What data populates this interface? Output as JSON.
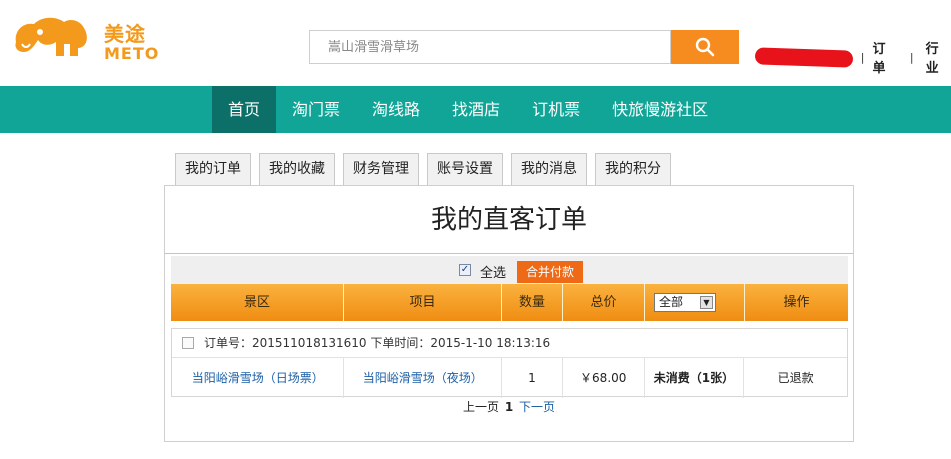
{
  "brand": {
    "name_cn": "美途",
    "name_en": "METO",
    "color": "#f39a1d"
  },
  "search": {
    "placeholder": "嵩山滑雪滑草场",
    "button_icon": "search-icon"
  },
  "userbar": {
    "orders_label": "订单",
    "industry_label": "行业",
    "separator": "|"
  },
  "nav": {
    "color": "#11a598",
    "items": [
      {
        "label": "首页",
        "active": true
      },
      {
        "label": "淘门票"
      },
      {
        "label": "淘线路"
      },
      {
        "label": "找酒店"
      },
      {
        "label": "订机票"
      },
      {
        "label": "快旅慢游社区"
      }
    ]
  },
  "tabs": [
    "我的订单",
    "我的收藏",
    "财务管理",
    "账号设置",
    "我的消息",
    "我的积分"
  ],
  "panel": {
    "title": "我的直客订单",
    "select_all_label": "全选",
    "merge_pay_label": "合并付款"
  },
  "table": {
    "headers": [
      "景区",
      "项目",
      "数量",
      "总价",
      "全部",
      "操作"
    ],
    "filter_value": "全部"
  },
  "orders": [
    {
      "header": "订单号：201511018131610 下单时间：2015-1-10 18:13:16",
      "scenic": "当阳峪滑雪场（日场票）",
      "item": "当阳峪滑雪场（夜场）",
      "quantity": "1",
      "price": "￥68.00",
      "status": "未消费（1张）",
      "action": "已退款"
    }
  ],
  "pager": {
    "prev": "上一页",
    "current": "1",
    "next": "下一页"
  }
}
